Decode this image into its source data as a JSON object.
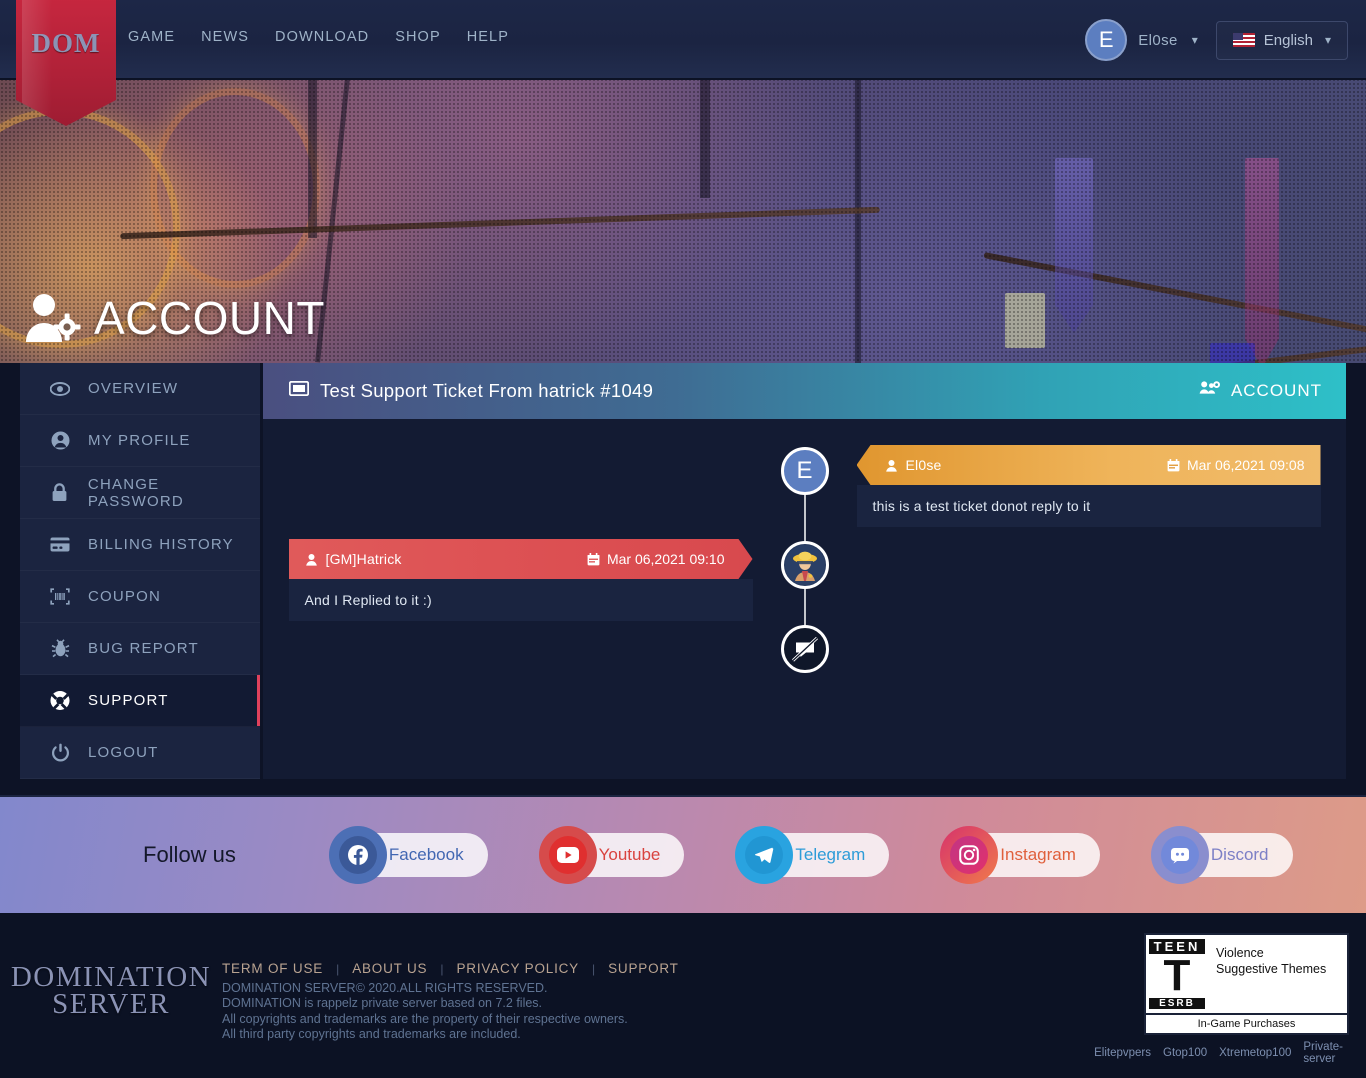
{
  "nav": {
    "logo_text": "DOM",
    "links": [
      "GAME",
      "NEWS",
      "DOWNLOAD",
      "SHOP",
      "HELP"
    ],
    "user": {
      "initial": "E",
      "name": "El0se"
    },
    "language": {
      "label": "English"
    }
  },
  "hero": {
    "title": "ACCOUNT"
  },
  "sidebar": {
    "items": [
      {
        "label": "OVERVIEW",
        "icon": "eye-icon",
        "active": false
      },
      {
        "label": "MY PROFILE",
        "icon": "user-icon",
        "active": false
      },
      {
        "label": "CHANGE PASSWORD",
        "icon": "lock-icon",
        "active": false
      },
      {
        "label": "BILLING HISTORY",
        "icon": "card-icon",
        "active": false
      },
      {
        "label": "COUPON",
        "icon": "barcode-icon",
        "active": false
      },
      {
        "label": "BUG REPORT",
        "icon": "bug-icon",
        "active": false
      },
      {
        "label": "SUPPORT",
        "icon": "lifering-icon",
        "active": true
      },
      {
        "label": "LOGOUT",
        "icon": "power-icon",
        "active": false
      }
    ]
  },
  "ticket": {
    "header_title": "Test Support Ticket From hatrick #1049",
    "header_badge": "ACCOUNT",
    "messages": [
      {
        "side": "right",
        "author": "El0se",
        "date": "Mar 06,2021 09:08",
        "body": "this is a test ticket donot reply to it",
        "avatar_letter": "E"
      },
      {
        "side": "left",
        "author": "[GM]Hatrick",
        "date": "Mar 06,2021 09:10",
        "body": "And I Replied to it :)",
        "avatar_letter": ""
      }
    ],
    "closed_icon": "no-reply-icon"
  },
  "follow": {
    "label": "Follow us",
    "socials": [
      {
        "name": "Facebook",
        "icon": "facebook-icon",
        "ring": "#4c6fb5",
        "badge": "#3b5998",
        "text": "#4267B2"
      },
      {
        "name": "Youtube",
        "icon": "youtube-icon",
        "ring": "#d64b4b",
        "badge": "#e02f2f",
        "text": "#d9433f"
      },
      {
        "name": "Telegram",
        "icon": "telegram-icon",
        "ring": "#29a3e0",
        "badge": "#2196d3",
        "text": "#2d9cd8"
      },
      {
        "name": "Instagram",
        "icon": "instagram-icon",
        "ring": "#d6336c",
        "badge": "#c13584",
        "text": "#e0603c"
      },
      {
        "name": "Discord",
        "icon": "discord-icon",
        "ring": "#8a8ece",
        "badge": "#7289da",
        "text": "#7d80c6"
      }
    ]
  },
  "footer": {
    "logo_line1": "DOMINATION",
    "logo_line2": "SERVER",
    "links": [
      "TERM OF USE",
      "ABOUT US",
      "PRIVACY POLICY",
      "SUPPORT"
    ],
    "legal": [
      "DOMINATION SERVER© 2020.ALL RIGHTS RESERVED.",
      "DOMINATION is rappelz private server based on 7.2 files.",
      "All copyrights and trademarks are the property of their respective owners.",
      "All third party copyrights and trademarks are included."
    ],
    "esrb": {
      "rating_word": "TEEN",
      "rating_letter": "T",
      "org": "ESRB",
      "descriptors": "Violence\nSuggestive Themes",
      "interactive": "In-Game Purchases"
    },
    "partners": [
      "Elitepvpers",
      "Gtop100",
      "Xtremetop100",
      "Private-server"
    ]
  }
}
